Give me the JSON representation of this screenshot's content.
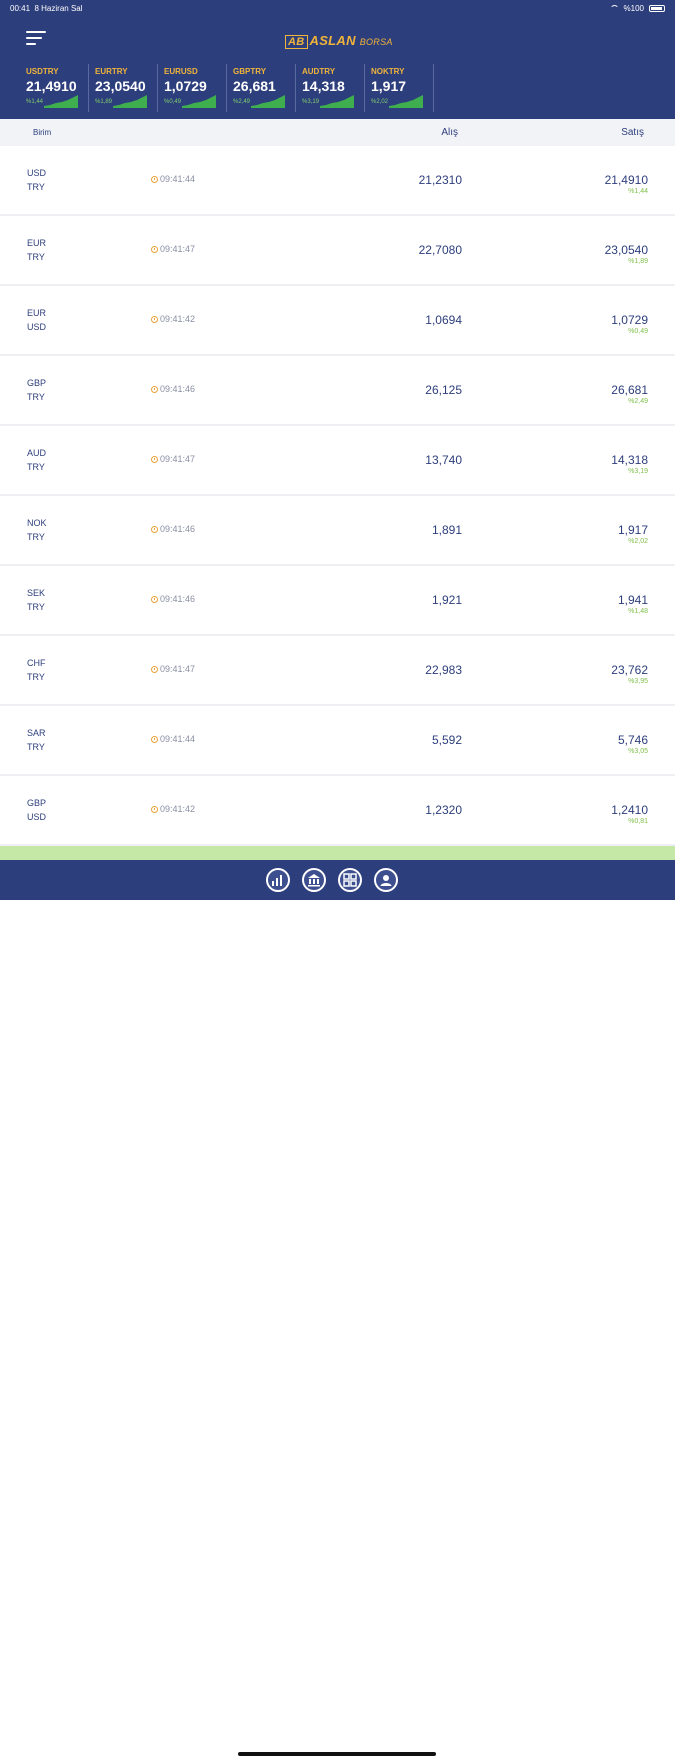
{
  "status": {
    "time": "00:41",
    "date": "8 Haziran Sal",
    "battery": "%100"
  },
  "app": {
    "logo_mark": "AB",
    "logo_text": "ASLAN",
    "logo_suffix": "BORSA"
  },
  "tickers": [
    {
      "symbol": "USDTRY",
      "value": "21,4910",
      "change": "%1,44"
    },
    {
      "symbol": "EURTRY",
      "value": "23,0540",
      "change": "%1,89"
    },
    {
      "symbol": "EURUSD",
      "value": "1,0729",
      "change": "%0,49"
    },
    {
      "symbol": "GBPTRY",
      "value": "26,681",
      "change": "%2,49"
    },
    {
      "symbol": "AUDTRY",
      "value": "14,318",
      "change": "%3,19"
    },
    {
      "symbol": "NOKTRY",
      "value": "1,917",
      "change": "%2,02"
    }
  ],
  "table": {
    "headers": {
      "unit": "Birim",
      "buy": "Alış",
      "sell": "Satış"
    },
    "rows": [
      {
        "base": "USD",
        "quote": "TRY",
        "time": "09:41:44",
        "buy": "21,2310",
        "sell": "21,4910",
        "change": "%1,44"
      },
      {
        "base": "EUR",
        "quote": "TRY",
        "time": "09:41:47",
        "buy": "22,7080",
        "sell": "23,0540",
        "change": "%1,89"
      },
      {
        "base": "EUR",
        "quote": "USD",
        "time": "09:41:42",
        "buy": "1,0694",
        "sell": "1,0729",
        "change": "%0,49"
      },
      {
        "base": "GBP",
        "quote": "TRY",
        "time": "09:41:46",
        "buy": "26,125",
        "sell": "26,681",
        "change": "%2,49"
      },
      {
        "base": "AUD",
        "quote": "TRY",
        "time": "09:41:47",
        "buy": "13,740",
        "sell": "14,318",
        "change": "%3,19"
      },
      {
        "base": "NOK",
        "quote": "TRY",
        "time": "09:41:46",
        "buy": "1,891",
        "sell": "1,917",
        "change": "%2,02"
      },
      {
        "base": "SEK",
        "quote": "TRY",
        "time": "09:41:46",
        "buy": "1,921",
        "sell": "1,941",
        "change": "%1,48"
      },
      {
        "base": "CHF",
        "quote": "TRY",
        "time": "09:41:47",
        "buy": "22,983",
        "sell": "23,762",
        "change": "%3,95"
      },
      {
        "base": "SAR",
        "quote": "TRY",
        "time": "09:41:44",
        "buy": "5,592",
        "sell": "5,746",
        "change": "%3,05"
      },
      {
        "base": "GBP",
        "quote": "USD",
        "time": "09:41:42",
        "buy": "1,2320",
        "sell": "1,2410",
        "change": "%0,81"
      }
    ]
  },
  "tabbar": {
    "icons": [
      "chart-icon",
      "bank-icon",
      "grid-icon",
      "user-icon"
    ]
  },
  "colors": {
    "primary": "#2d3e7c",
    "accent": "#f0b43a",
    "positive": "#7fbf4a"
  }
}
